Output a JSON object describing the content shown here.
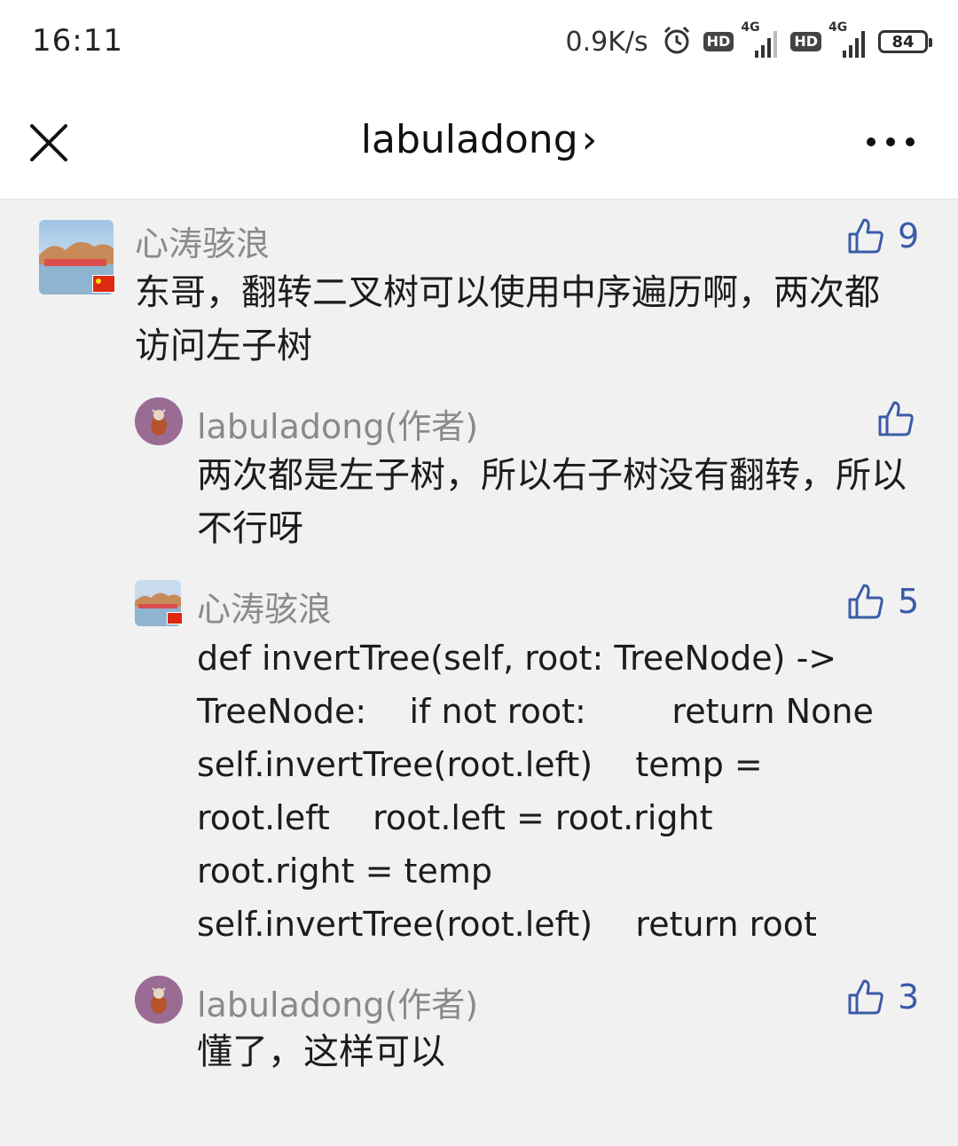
{
  "status_bar": {
    "time": "16:11",
    "speed": "0.9K/s",
    "hd_label": "HD",
    "net_label": "4G",
    "battery": "84"
  },
  "header": {
    "title": "labuladong",
    "chevron": "›"
  },
  "comments": [
    {
      "author": "心涛骇浪",
      "likes": "9",
      "text": "东哥，翻转二叉树可以使用中序遍历啊，两次都访问左子树"
    },
    {
      "author": "labuladong(作者)",
      "likes": "",
      "text": "两次都是左子树，所以右子树没有翻转，所以不行呀"
    },
    {
      "author": "心涛骇浪",
      "likes": "5",
      "code_lines": [
        "def invertTree(self, root: TreeNode) ->",
        "TreeNode:    if not root:        return None",
        "self.invertTree(root.left)    temp =",
        "root.left    root.left = root.right",
        "root.right = temp",
        "self.invertTree(root.left)    return root"
      ]
    },
    {
      "author": "labuladong(作者)",
      "likes": "3",
      "text": "懂了，这样可以"
    }
  ],
  "colors": {
    "accent": "#3b5ba8",
    "name": "#8a8a8a",
    "background": "#f1f1f1"
  },
  "icons": [
    "close-icon",
    "more-icon",
    "thumbs-up-icon",
    "alarm-icon",
    "signal-icon",
    "battery-icon",
    "flag-icon"
  ]
}
